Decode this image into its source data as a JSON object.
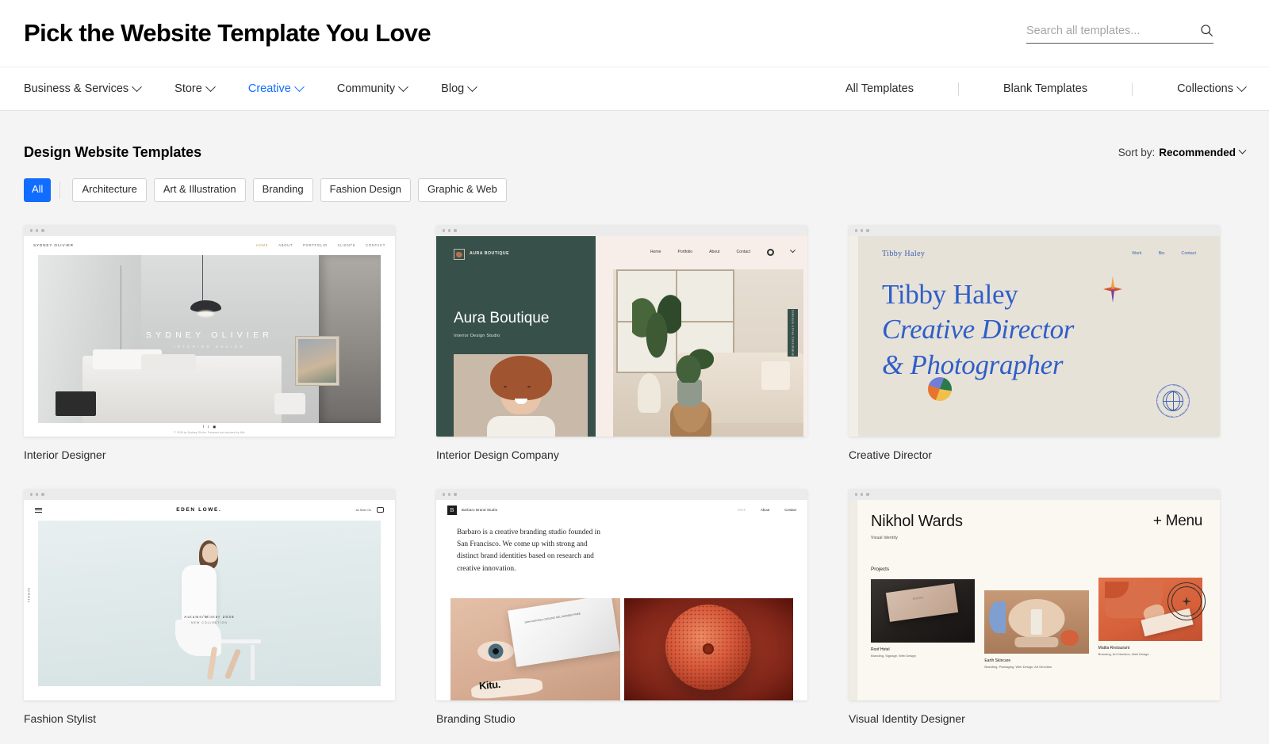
{
  "header": {
    "title": "Pick the Website Template You Love",
    "search_placeholder": "Search all templates...",
    "search_value": "",
    "search_icon": "search-icon"
  },
  "nav": {
    "left": [
      {
        "label": "Business & Services",
        "active": false,
        "caret": true
      },
      {
        "label": "Store",
        "active": false,
        "caret": true
      },
      {
        "label": "Creative",
        "active": true,
        "caret": true
      },
      {
        "label": "Community",
        "active": false,
        "caret": true
      },
      {
        "label": "Blog",
        "active": false,
        "caret": true
      }
    ],
    "right": [
      {
        "label": "All Templates",
        "caret": false
      },
      {
        "label": "Blank Templates",
        "caret": false
      },
      {
        "label": "Collections",
        "caret": true
      }
    ]
  },
  "section": {
    "title": "Design Website Templates",
    "sort_prefix": "Sort by:",
    "sort_value": "Recommended"
  },
  "filters": [
    {
      "label": "All",
      "selected": true
    },
    {
      "label": "Architecture",
      "selected": false
    },
    {
      "label": "Art & Illustration",
      "selected": false
    },
    {
      "label": "Branding",
      "selected": false
    },
    {
      "label": "Fashion Design",
      "selected": false
    },
    {
      "label": "Graphic & Web",
      "selected": false
    }
  ],
  "templates": [
    {
      "name": "Interior Designer",
      "preview": {
        "logo": "SYDNEY OLIVIER",
        "nav": [
          "HOME",
          "ABOUT",
          "PORTFOLIO",
          "CLIENTS",
          "CONTACT"
        ],
        "hero_title": "SYDNEY OLIVIER",
        "hero_subtitle": "INTERIOR DESIGN",
        "footer_copy": "© 2035 by Sydney Olivier. Powered and secured by Wix"
      }
    },
    {
      "name": "Interior Design Company",
      "preview": {
        "logo": "AURA BOUTIQUE",
        "nav": [
          "Home",
          "Portfolio",
          "About",
          "Contact"
        ],
        "hero_title": "Aura Boutique",
        "hero_subtitle": "Interior Design Studio",
        "side_tab": "Schedule a Free Consultation"
      }
    },
    {
      "name": "Creative Director",
      "preview": {
        "logo": "Tibby Haley",
        "nav": [
          "Work",
          "Bio",
          "Contact"
        ],
        "hero_line1": "Tibby Haley",
        "hero_line2": "Creative Director",
        "hero_line3": "& Photographer",
        "badge_text": "WORK AROUND THE GLOBE • WORK AROUND THE GLOBE • "
      }
    },
    {
      "name": "Fashion Stylist",
      "preview": {
        "logo": "EDEN LOWE.",
        "nav_right": "As Seen On",
        "caption_title": "Autumn/Winter 2035",
        "caption_sub": "NEW COLLECTION",
        "side_text": "SCROLL"
      }
    },
    {
      "name": "Branding Studio",
      "preview": {
        "logo": "Barbaro Brand Studio",
        "nav": [
          "Work",
          "About",
          "Contact"
        ],
        "paragraph": "Barbaro is a creative branding studio founded in San Francisco. We come up with strong and distinct brand identities based on research and creative innovation.",
        "product_mark": "Kitu.",
        "box_lines": "100% NATURAL\nCOOLING GEL\nPARABEN FREE"
      }
    },
    {
      "name": "Visual Identity Designer",
      "preview": {
        "brand": "Nikhol Wards",
        "subtitle": "Visual Identity",
        "menu": "+ Menu",
        "section": "Projects",
        "projects": [
          {
            "title": "Roof Hotel",
            "tags": "Branding, Signage, Web Design"
          },
          {
            "title": "Earth Skincare",
            "tags": "Branding, Packaging, Web Design, Art Direction"
          },
          {
            "title": "Mattia Restaurant",
            "tags": "Branding, Art Direction, Web Design"
          }
        ],
        "stamp_text": "SAY HI • SAY HI • SAY HI • "
      }
    }
  ],
  "colors": {
    "accent": "#116dff",
    "page_bg": "#f4f4f4",
    "header_bg": "#ffffff",
    "text": "#2b2b2b"
  }
}
